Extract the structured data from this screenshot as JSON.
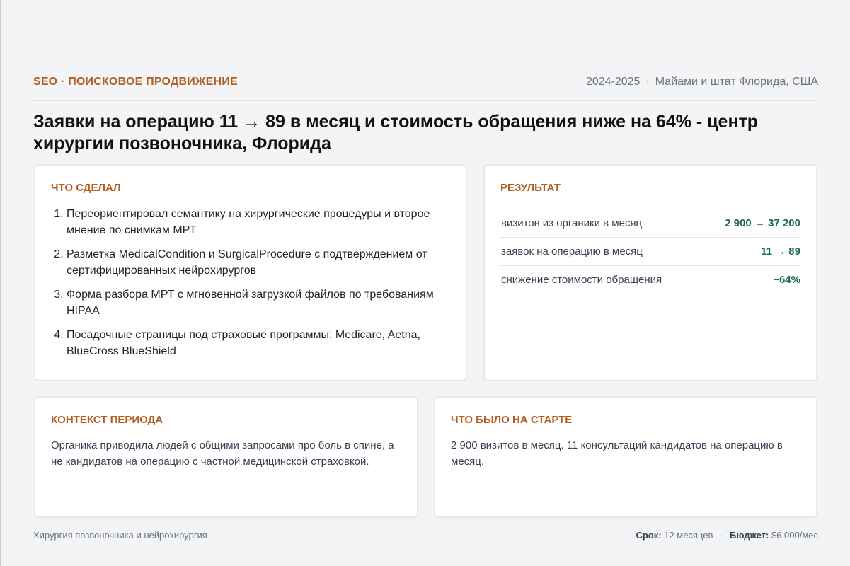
{
  "header": {
    "eyebrow": "SEO · ПОИСКОВОЕ ПРОДВИЖЕНИЕ",
    "years": "2024-2025",
    "separator": "·",
    "location": "Майами и штат Флорида, США"
  },
  "title": "Заявки на операцию 11 → 89 в месяц и стоимость обращения ниже на 64% - центр хирургии позвоночника, Флорида",
  "work": {
    "title": "ЧТО СДЕЛАЛ",
    "items": [
      "Переориентировал семантику на хирургические процедуры и второе мнение по снимкам МРТ",
      "Разметка MedicalCondition и SurgicalProcedure с подтверждением от сертифицированных нейрохирургов",
      "Форма разбора МРТ с мгновенной загрузкой файлов по требованиям HIPAA",
      "Посадочные страницы под страховые программы: Medicare, Aetna, BlueCross BlueShield"
    ]
  },
  "result": {
    "title": "РЕЗУЛЬТАТ",
    "metrics": [
      {
        "label": "визитов из органики в месяц",
        "value": "2 900 → 37 200"
      },
      {
        "label": "заявок на операцию в месяц",
        "value": "11 → 89"
      },
      {
        "label": "снижение стоимости обращения",
        "value": "−64%"
      }
    ]
  },
  "context": {
    "title": "КОНТЕКСТ ПЕРИОДА",
    "text": "Органика приводила людей с общими запросами про боль в спине, а не кандидатов на операцию с частной медицинской страховкой."
  },
  "start": {
    "title": "ЧТО БЫЛО НА СТАРТЕ",
    "text": "2 900 визитов в месяц. 11 консультаций кандидатов на операцию в месяц."
  },
  "footer": {
    "category": "Хирургия позвоночника и нейрохирургия",
    "term_label": "Срок:",
    "term_value": "12 месяцев",
    "separator": "·",
    "budget_label": "Бюджет:",
    "budget_value": "$6 000/мес"
  },
  "colors": {
    "accent": "#b45f22",
    "metric_value": "#1f6b48",
    "background": "#f3f4f6"
  }
}
